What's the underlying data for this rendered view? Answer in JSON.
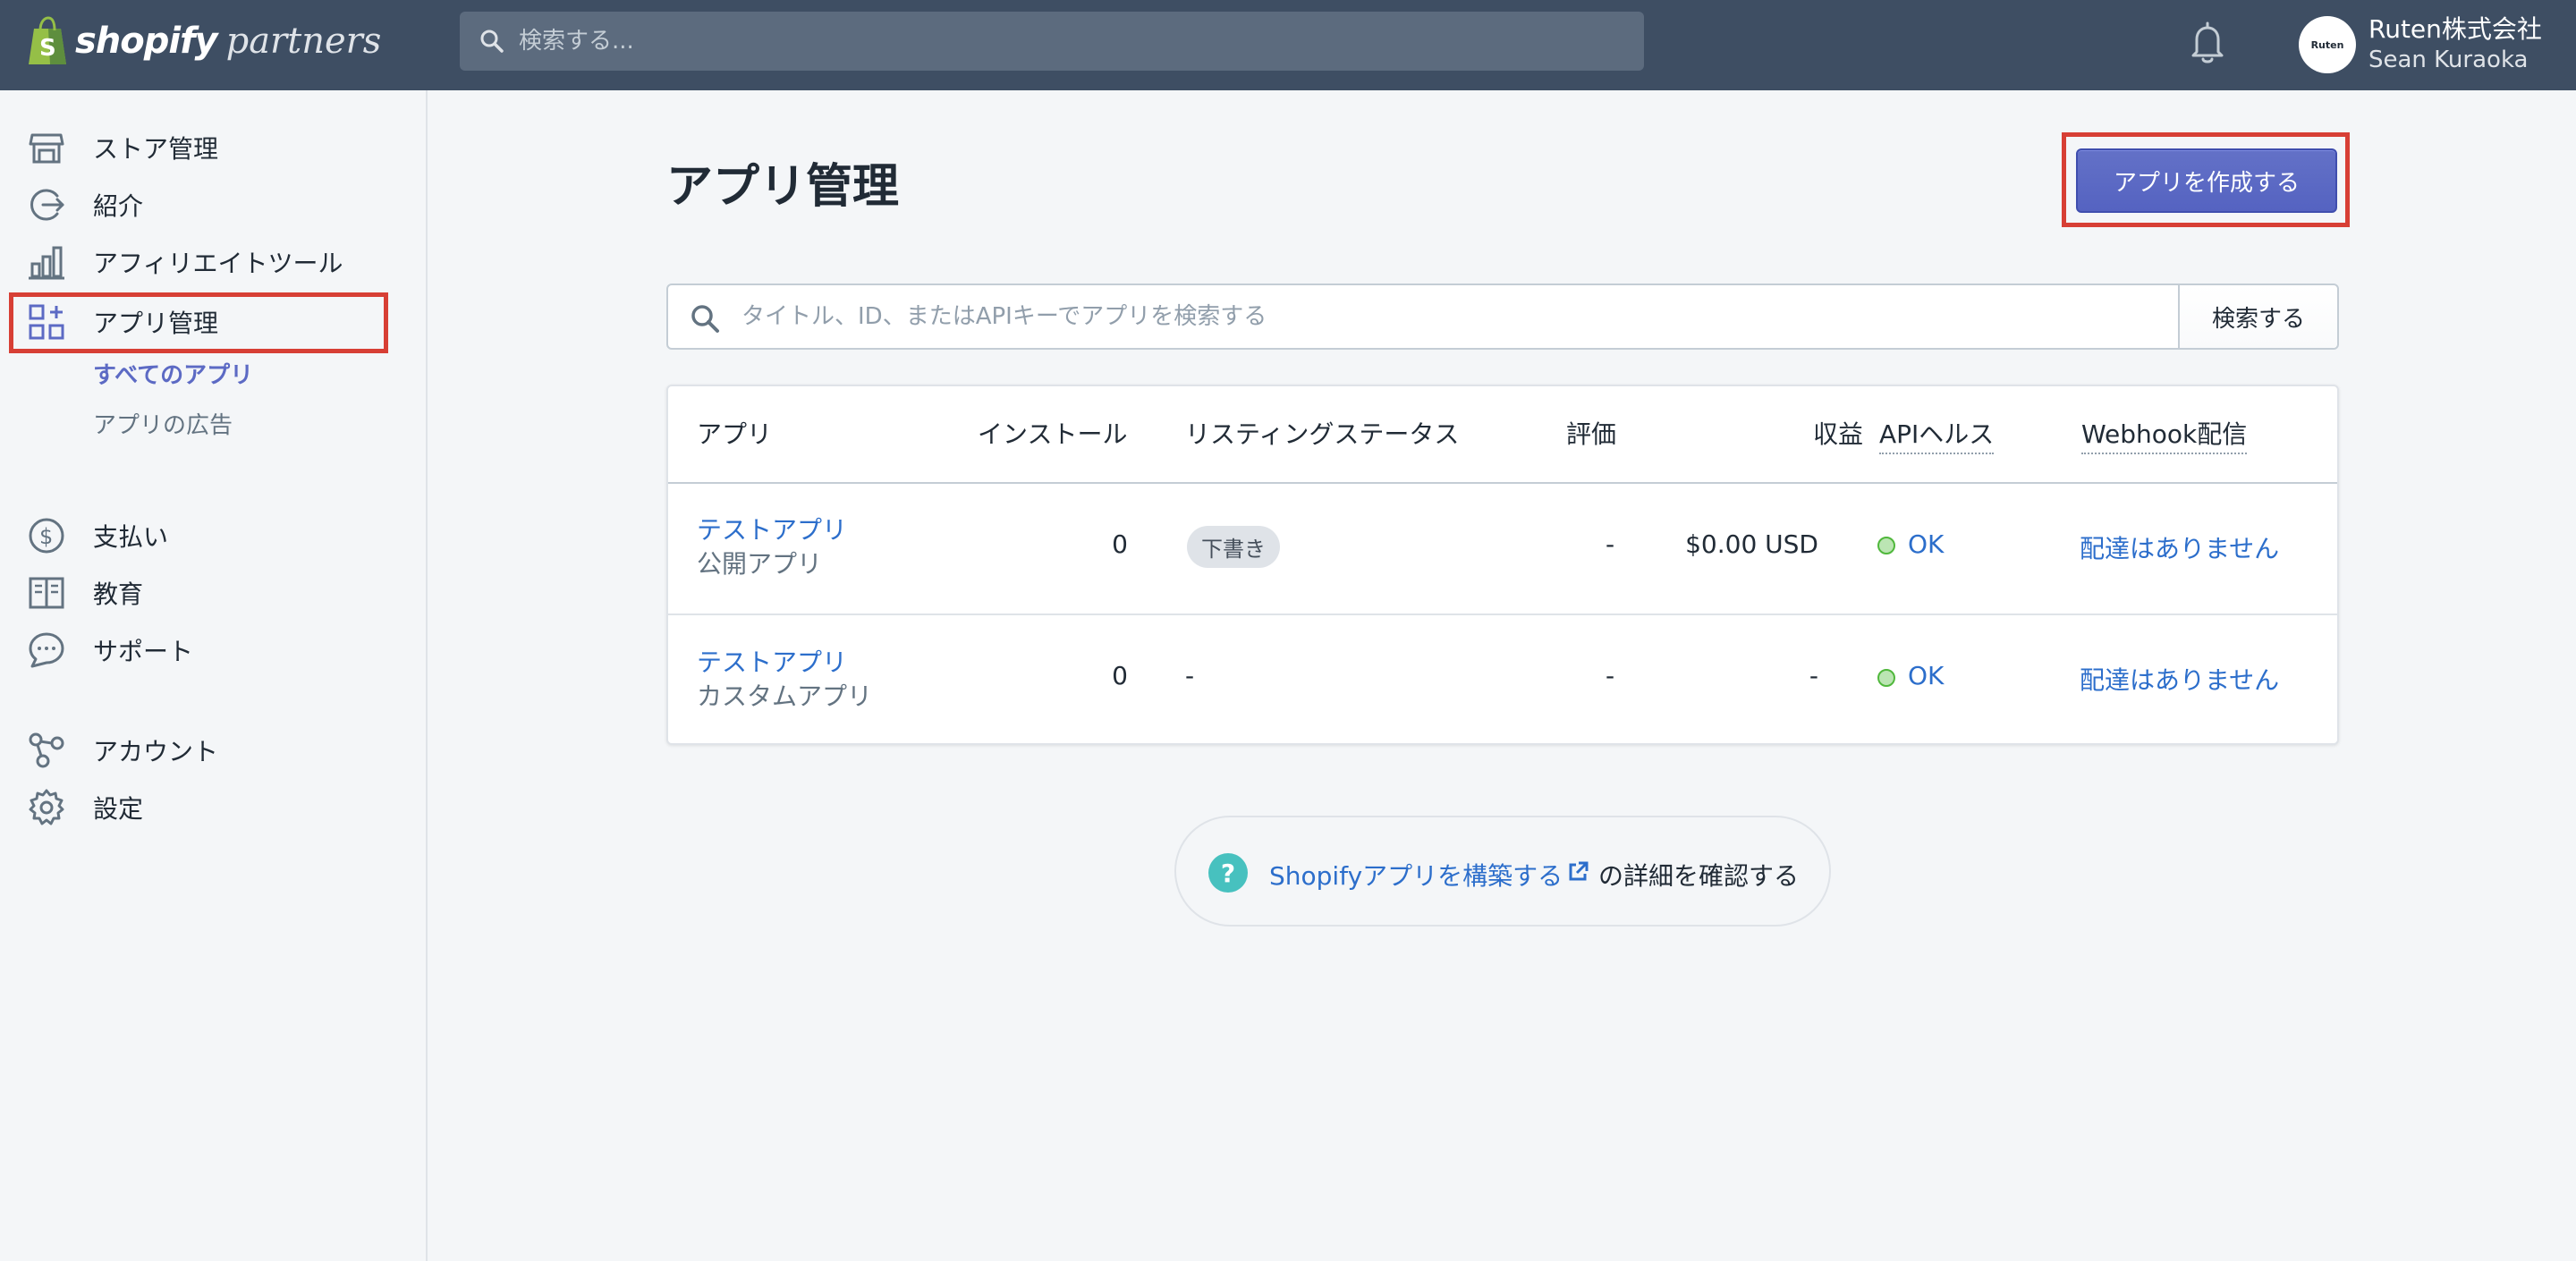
{
  "topbar": {
    "brand": "shopify",
    "brand_sub": "partners",
    "search_placeholder": "検索する...",
    "user_org": "Ruten株式会社",
    "user_name": "Sean Kuraoka",
    "avatar_text": "Ruten"
  },
  "sidebar": {
    "items": [
      {
        "label": "ストア管理",
        "icon": "store-icon"
      },
      {
        "label": "紹介",
        "icon": "referral-icon"
      },
      {
        "label": "アフィリエイトツール",
        "icon": "chart-icon"
      },
      {
        "label": "アプリ管理",
        "icon": "apps-icon"
      },
      {
        "label": "支払い",
        "icon": "dollar-icon"
      },
      {
        "label": "教育",
        "icon": "book-icon"
      },
      {
        "label": "サポート",
        "icon": "chat-icon"
      },
      {
        "label": "アカウント",
        "icon": "account-icon"
      },
      {
        "label": "設定",
        "icon": "gear-icon"
      }
    ],
    "sub_items": [
      "すべてのアプリ",
      "アプリの広告"
    ]
  },
  "main": {
    "title": "アプリ管理",
    "create_button": "アプリを作成する",
    "search_placeholder": "タイトル、ID、またはAPIキーでアプリを検索する",
    "search_button": "検索する",
    "table": {
      "headers": [
        "アプリ",
        "インストール",
        "リスティングステータス",
        "評価",
        "収益",
        "APIヘルス",
        "Webhook配信"
      ],
      "rows": [
        {
          "name": "テストアプリ",
          "type": "公開アプリ",
          "installs": "0",
          "status": "下書き",
          "rating": "-",
          "revenue": "$0.00 USD",
          "api": "OK",
          "webhook": "配達はありません"
        },
        {
          "name": "テストアプリ",
          "type": "カスタムアプリ",
          "installs": "0",
          "status": "-",
          "rating": "-",
          "revenue": "-",
          "api": "OK",
          "webhook": "配達はありません"
        }
      ]
    },
    "help": {
      "icon": "?",
      "link": "Shopifyアプリを構築する",
      "rest": "の詳細を確認する"
    }
  },
  "colors": {
    "topbar": "#3e4e63",
    "accent": "#5c6ac4",
    "link": "#2c6ecb",
    "highlight": "#d73f35",
    "ok": "#50b83c"
  }
}
